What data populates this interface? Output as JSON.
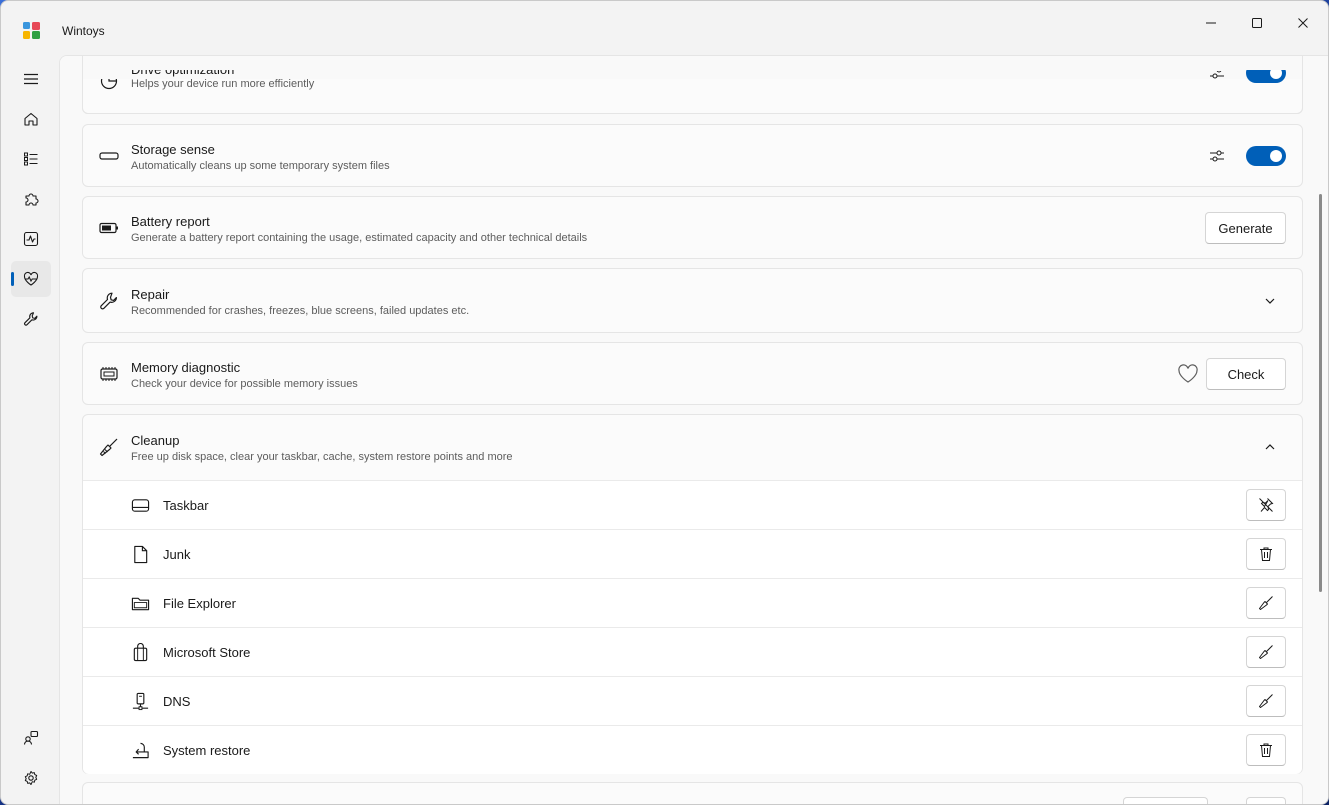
{
  "window": {
    "title": "Wintoys",
    "minimize_icon": "minimize-icon",
    "maximize_icon": "maximize-icon",
    "close_icon": "close-icon"
  },
  "nav": {
    "items": [
      {
        "icon": "hamburger-menu-icon"
      },
      {
        "icon": "home-icon"
      },
      {
        "icon": "apps-list-icon"
      },
      {
        "icon": "puzzle-icon"
      },
      {
        "icon": "performance-pulse-icon"
      },
      {
        "icon": "health-heart-icon",
        "selected": true
      },
      {
        "icon": "wrench-icon"
      }
    ],
    "footer": [
      {
        "icon": "account-switch-icon"
      },
      {
        "icon": "settings-gear-icon"
      }
    ]
  },
  "cards": {
    "drive_opt": {
      "title": "Drive optimization",
      "subtitle": "Helps your device run more efficiently",
      "icon": "drive-optimization-icon",
      "toggle_on": true
    },
    "storage": {
      "title": "Storage sense",
      "subtitle": "Automatically cleans up some temporary system files",
      "icon": "storage-drive-icon",
      "toggle_on": true
    },
    "battery": {
      "title": "Battery report",
      "subtitle": "Generate a battery report containing the usage, estimated capacity and other technical details",
      "icon": "battery-icon",
      "button": "Generate"
    },
    "repair": {
      "title": "Repair",
      "subtitle": "Recommended for crashes, freezes, blue screens, failed updates etc.",
      "icon": "wrench-icon",
      "expanded": false
    },
    "memory": {
      "title": "Memory diagnostic",
      "subtitle": "Check your device for possible memory issues",
      "icon": "memory-chip-icon",
      "button": "Check",
      "favorite_icon": "heart-outline-icon"
    },
    "cleanup": {
      "title": "Cleanup",
      "subtitle": "Free up disk space, clear your taskbar, cache, system restore points and more",
      "icon": "broom-icon",
      "expanded": true,
      "items": [
        {
          "label": "Taskbar",
          "icon": "taskbar-icon",
          "action_icon": "unpin-icon"
        },
        {
          "label": "Junk",
          "icon": "document-icon",
          "action_icon": "trash-icon"
        },
        {
          "label": "File Explorer",
          "icon": "folder-icon",
          "action_icon": "broom-icon"
        },
        {
          "label": "Microsoft Store",
          "icon": "store-bag-icon",
          "action_icon": "broom-icon"
        },
        {
          "label": "DNS",
          "icon": "dns-network-icon",
          "action_icon": "broom-icon"
        },
        {
          "label": "System restore",
          "icon": "system-restore-icon",
          "action_icon": "trash-icon"
        }
      ]
    }
  },
  "colors": {
    "accent": "#005fb8",
    "window_bg": "#f3f3f3",
    "card_bg": "#fbfbfb"
  }
}
